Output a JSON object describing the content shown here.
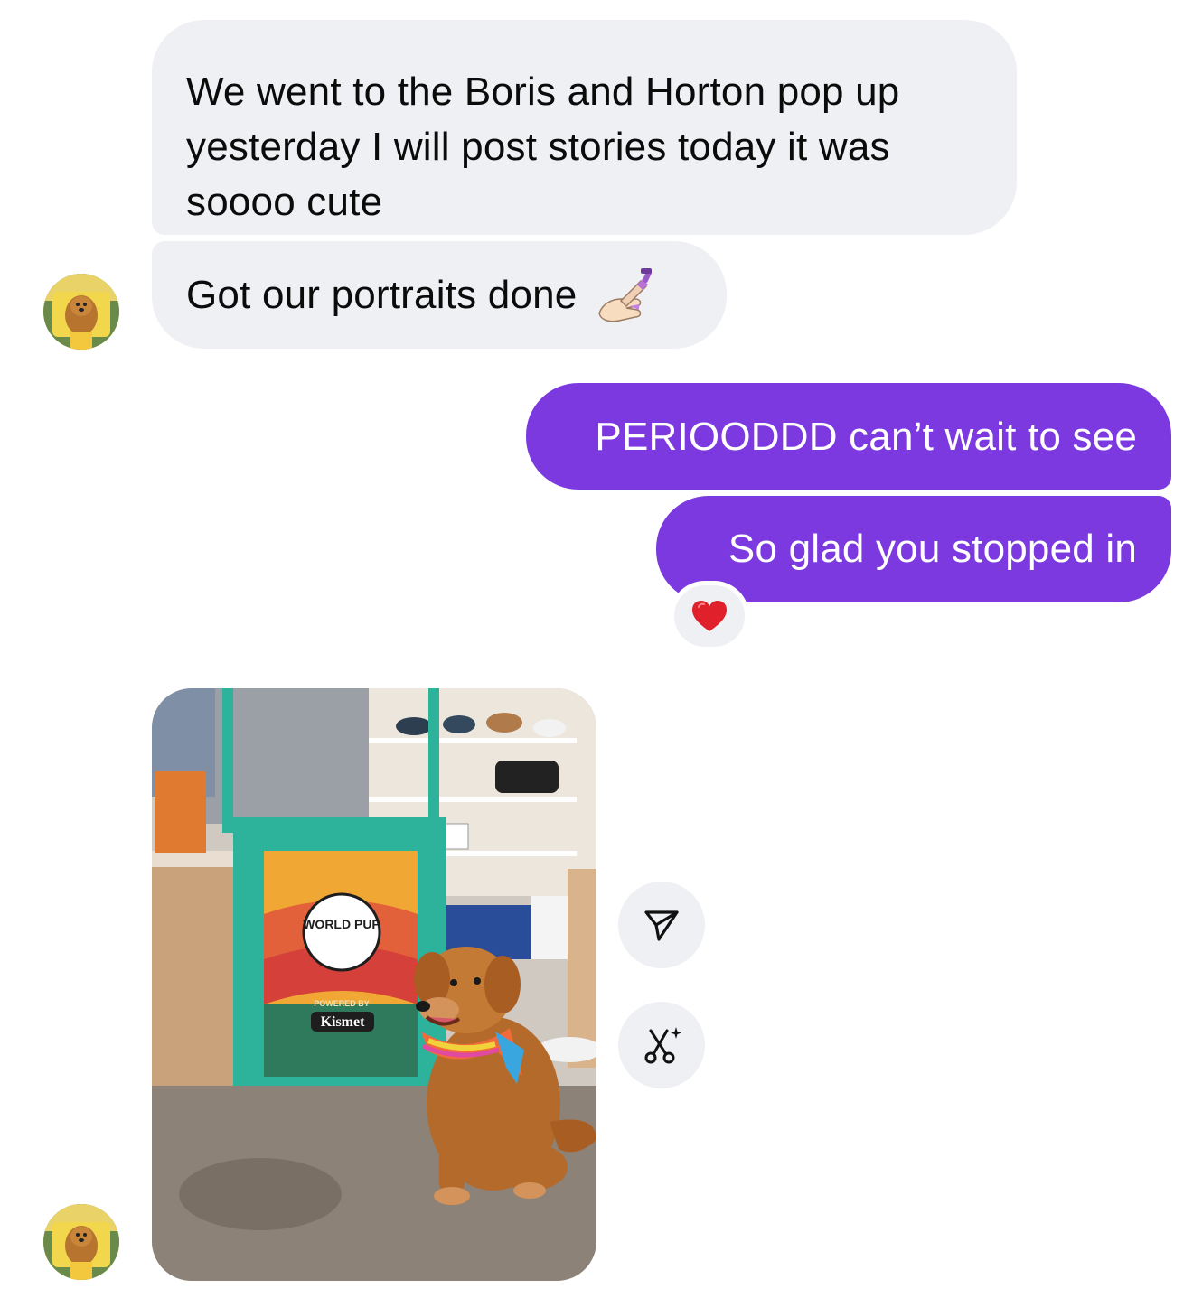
{
  "messages": [
    {
      "sender": "them",
      "text": "We went to the Boris and Horton pop up yesterday I will post stories today it was soooo cute"
    },
    {
      "sender": "them",
      "text": "Got our portraits done",
      "emoji": "nail-polish-emoji"
    },
    {
      "sender": "me",
      "text": "PERIOODDD can’t wait to see"
    },
    {
      "sender": "me",
      "text": "So glad you stopped in",
      "reaction": "❤️"
    }
  ],
  "photo_message": {
    "sender": "them",
    "image": "photo of golden retriever with bandana beside World Pup stand",
    "sign": {
      "line1": "WORLD PUP",
      "line2": "POWERED BY",
      "line3": "Kismet"
    }
  },
  "actions": {
    "share_icon": "send-icon",
    "edit_icon": "scissors-sparkle-icon"
  },
  "colors": {
    "incoming_bubble": "#eff0f3",
    "outgoing_bubble": "#7c39e0",
    "reaction_heart": "#e0202a"
  }
}
